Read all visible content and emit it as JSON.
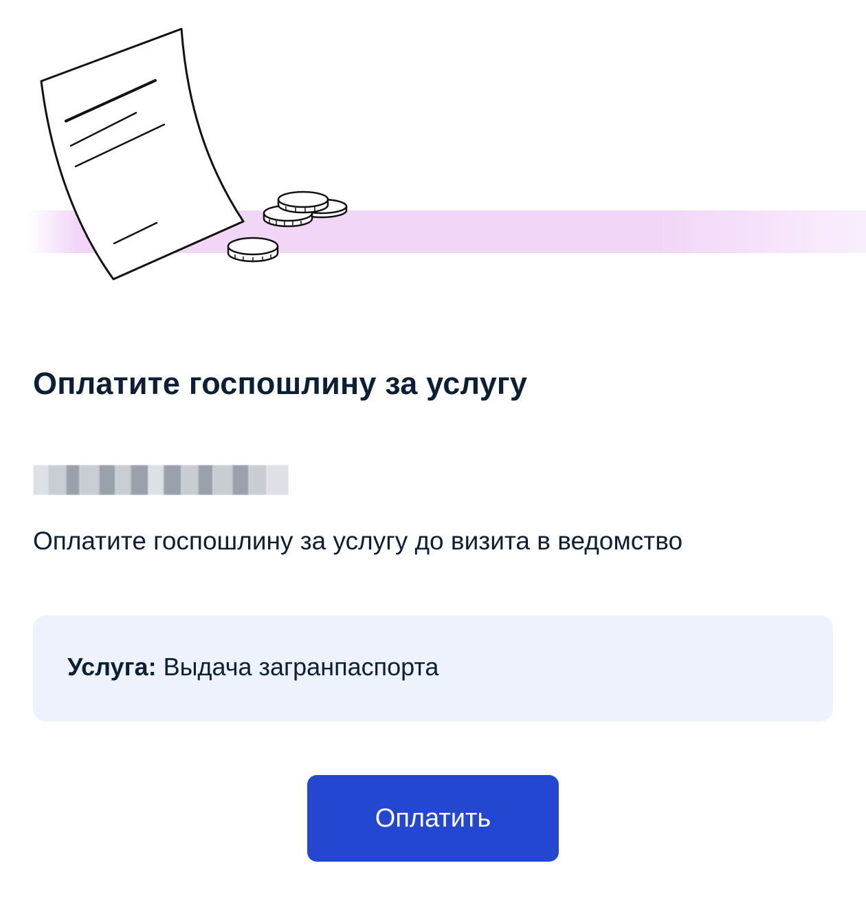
{
  "illustration": {
    "name": "document-and-coins",
    "band_color": "#f1d6f8"
  },
  "title": "Оплатите госпошлину за услугу",
  "recipient": {
    "blurred": true
  },
  "description": "Оплатите госпошлину за услугу до визита в ведомство",
  "service_card": {
    "label": "Услуга:",
    "value": "Выдача загранпаспорта"
  },
  "pay_button": {
    "label": "Оплатить"
  },
  "colors": {
    "primary": "#2347d0",
    "text": "#0b1f35",
    "card_background": "#edf2fd"
  }
}
